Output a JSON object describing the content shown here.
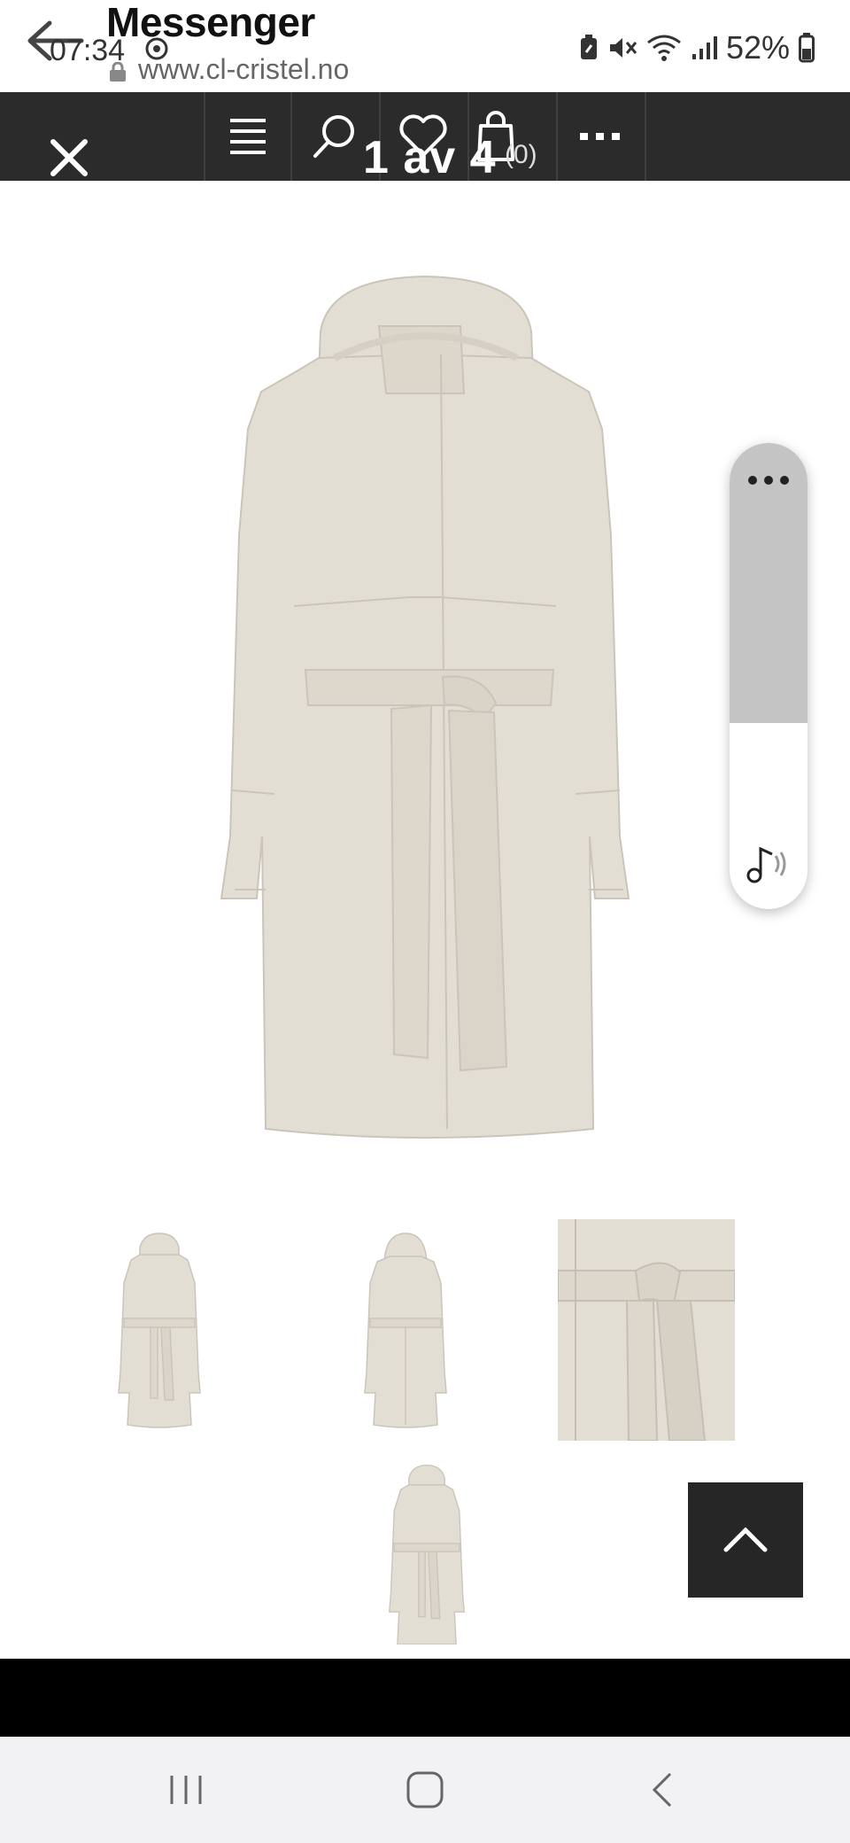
{
  "status_bar": {
    "app_name": "Messenger",
    "time": "07:34",
    "url": "www.cl-cristel.no",
    "battery": "52%"
  },
  "site_nav": {
    "image_counter": "1 av 4",
    "cart_count": "(0)"
  },
  "icons": {
    "back": "arrow-left-icon",
    "close": "close-icon",
    "menu": "menu-icon",
    "search": "search-icon",
    "wishlist": "heart-icon",
    "cart": "shopping-bag-icon",
    "more": "more-dots-icon",
    "scroll_top": "chevron-up-icon",
    "music": "music-icon"
  },
  "colors": {
    "nav_bg": "#2b2b2b",
    "coat": "#e3ded4",
    "scroll_btn": "#262626",
    "float_panel_top": "#c4c4c4"
  }
}
